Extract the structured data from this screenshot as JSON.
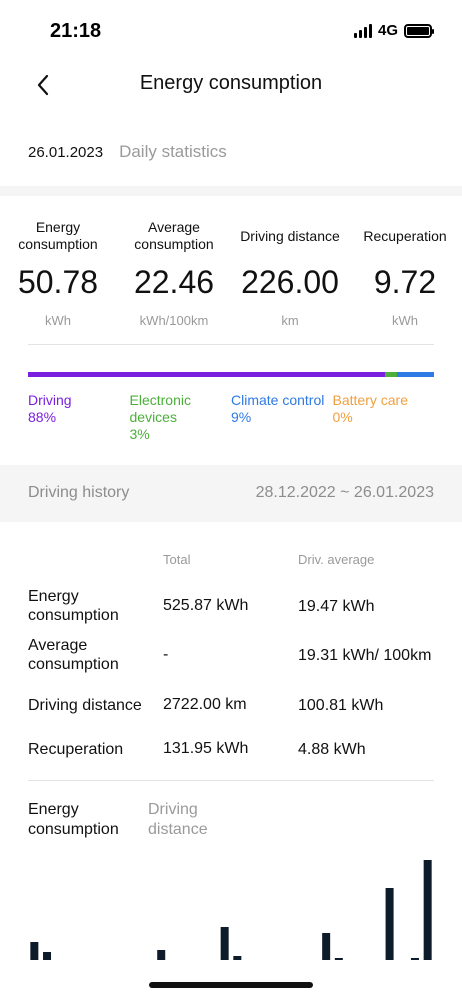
{
  "status_bar": {
    "time": "21:18",
    "network": "4G",
    "battery_level": 1.0
  },
  "header": {
    "title": "Energy consumption",
    "back_icon": "chevron-left-icon"
  },
  "date_selector": {
    "date": "26.01.2023",
    "tab_label": "Daily statistics"
  },
  "summary": [
    {
      "label": "Energy consumption",
      "value": "50.78",
      "unit": "kWh"
    },
    {
      "label": "Average consumption",
      "value": "22.46",
      "unit": "kWh/100km"
    },
    {
      "label": "Driving distance",
      "value": "226.00",
      "unit": "km"
    },
    {
      "label": "Recuperation",
      "value": "9.72",
      "unit": "kWh"
    }
  ],
  "breakdown": [
    {
      "label": "Driving",
      "percent": "88%",
      "share": 88,
      "color": "#7a1fe0"
    },
    {
      "label": "Electronic devices",
      "percent": "3%",
      "share": 3,
      "color": "#4caf3a"
    },
    {
      "label": "Climate control",
      "percent": "9%",
      "share": 9,
      "color": "#2f7ae5"
    },
    {
      "label": "Battery care",
      "percent": "0%",
      "share": 0,
      "color": "#f0a040"
    }
  ],
  "history": {
    "title": "Driving history",
    "range": "28.12.2022 ~ 26.01.2023",
    "headers": {
      "total": "Total",
      "average": "Driv. average"
    },
    "rows": [
      {
        "label": "Energy consumption",
        "total": "525.87 kWh",
        "average": "19.47 kWh"
      },
      {
        "label": "Average consumption",
        "total": "-",
        "average": "19.31 kWh/ 100km"
      },
      {
        "label": "Driving distance",
        "total": "2722.00 km",
        "average": "100.81 kWh"
      },
      {
        "label": "Recuperation",
        "total": "131.95 kWh",
        "average": "4.88 kWh"
      }
    ]
  },
  "chart_tabs": {
    "active": "Energy consumption",
    "inactive": "Driving distance"
  },
  "chart_data": {
    "type": "bar",
    "title": "",
    "xlabel": "",
    "ylabel": "",
    "bar_color": "#0d1b2a",
    "ylim": [
      0,
      100
    ],
    "values": [
      18,
      8,
      0,
      0,
      0,
      0,
      0,
      0,
      0,
      0,
      10,
      0,
      0,
      0,
      0,
      33,
      4,
      0,
      0,
      0,
      0,
      0,
      0,
      27,
      2,
      0,
      0,
      0,
      72,
      0,
      2,
      100
    ]
  }
}
